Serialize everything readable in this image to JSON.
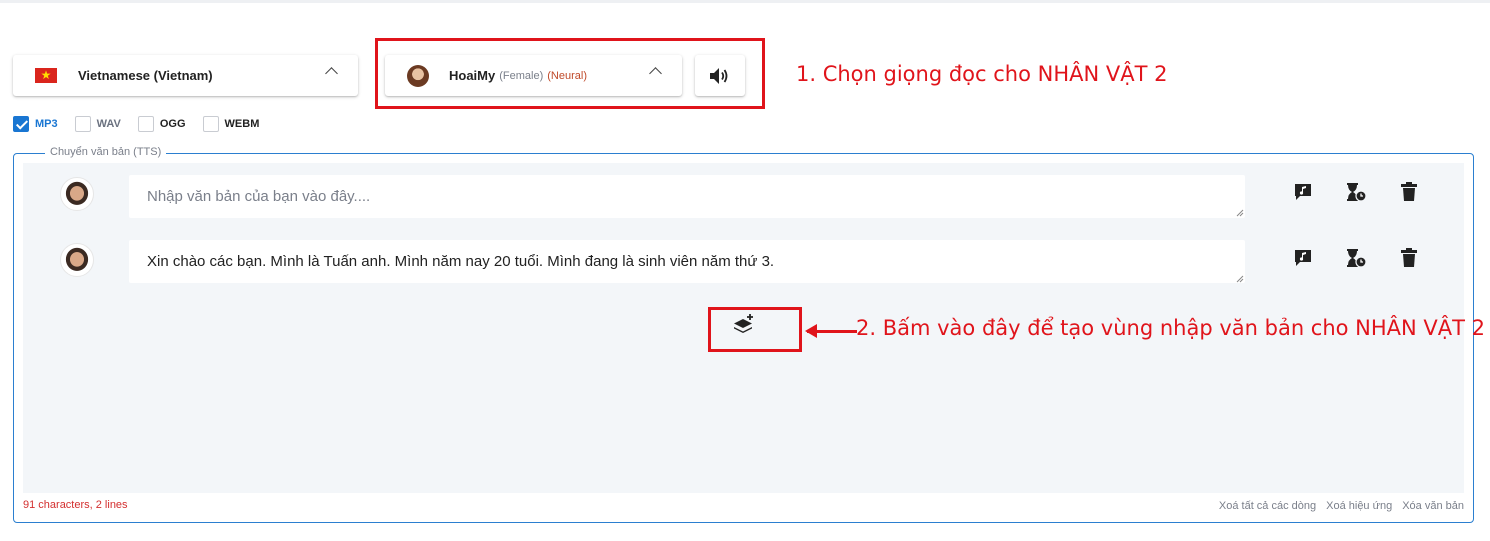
{
  "language": {
    "flag": "vietnam-flag-icon",
    "label": "Vietnamese (Vietnam)"
  },
  "voice": {
    "name": "HoaiMy",
    "gender": "(Female)",
    "type": "(Neural)"
  },
  "annotations": {
    "step1": "1. Chọn giọng đọc cho NHÂN VẬT 2",
    "step2": "2. Bấm vào đây để tạo vùng nhập văn bản cho NHÂN VẬT 2"
  },
  "formats": [
    {
      "label": "MP3",
      "checked": true
    },
    {
      "label": "WAV",
      "checked": false
    },
    {
      "label": "OGG",
      "checked": false
    },
    {
      "label": "WEBM",
      "checked": false
    }
  ],
  "tts": {
    "legend": "Chuyển văn bản (TTS)",
    "rows": [
      {
        "placeholder": "Nhập văn bản của bạn vào đây....",
        "value": ""
      },
      {
        "placeholder": "Nhập văn bản của bạn vào đây....",
        "value": "Xin chào các bạn. Mình là Tuấn anh. Mình năm nay 20 tuổi. Mình đang là sinh viên năm thứ 3."
      }
    ],
    "row_icons": [
      "music-note-comment-icon",
      "hourglass-clock-icon",
      "trash-icon"
    ],
    "char_count": "91 characters, 2 lines",
    "footer_links": [
      "Xoá tất cả các dòng",
      "Xoá hiệu ứng",
      "Xóa văn bản"
    ]
  },
  "colors": {
    "accent": "#1976d2",
    "annotation": "#e0141b",
    "panel": "#f3f6f9"
  }
}
